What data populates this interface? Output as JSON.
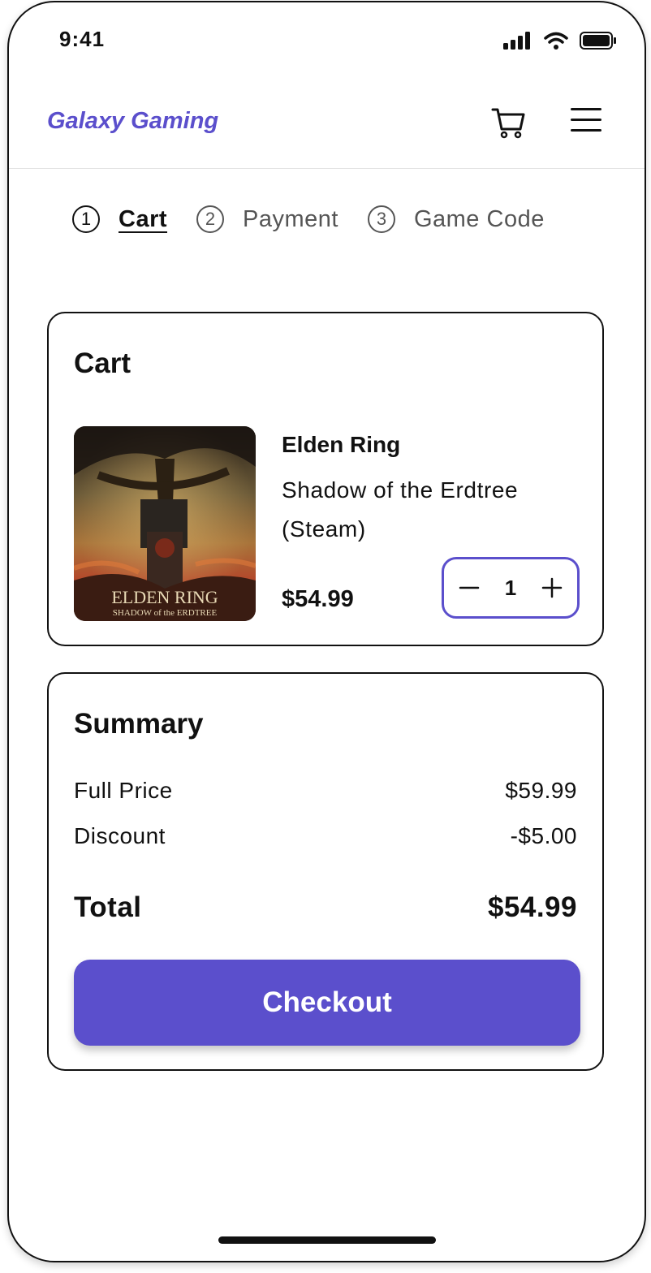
{
  "status_bar": {
    "time": "9:41"
  },
  "header": {
    "brand": "Galaxy Gaming"
  },
  "steps": [
    {
      "num": "1",
      "label": "Cart"
    },
    {
      "num": "2",
      "label": "Payment"
    },
    {
      "num": "3",
      "label": "Game Code"
    }
  ],
  "cart": {
    "title": "Cart",
    "item": {
      "name": "Elden Ring",
      "subtitle": "Shadow of the Erdtree (Steam)",
      "price": "$54.99",
      "quantity": "1",
      "cover_logo_line1": "ELDEN RING",
      "cover_logo_line2": "SHADOW of the ERDTREE"
    }
  },
  "summary": {
    "title": "Summary",
    "full_price_label": "Full Price",
    "full_price_value": "$59.99",
    "discount_label": "Discount",
    "discount_value": "-$5.00",
    "total_label": "Total",
    "total_value": "$54.99",
    "checkout_label": "Checkout"
  },
  "colors": {
    "accent": "#5b4fcc",
    "border": "#111111"
  },
  "icons": [
    "signal-icon",
    "wifi-icon",
    "battery-icon",
    "cart-icon",
    "menu-icon",
    "minus-icon",
    "plus-icon"
  ]
}
